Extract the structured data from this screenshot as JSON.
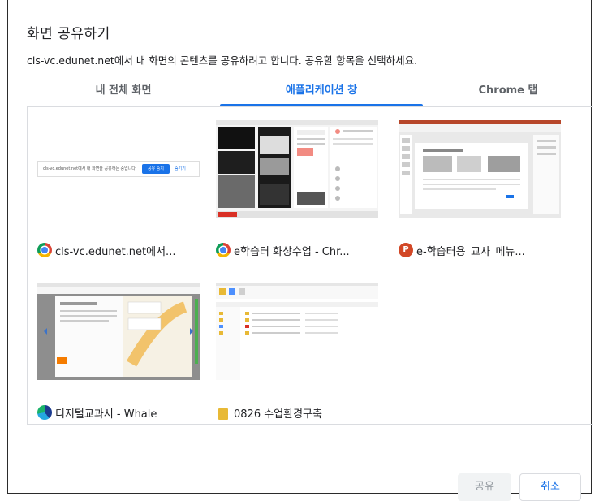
{
  "dialog": {
    "title": "화면 공유하기",
    "subtitle": "cls-vc.edunet.net에서 내 화면의 콘텐츠를 공유하려고 합니다. 공유할 항목을 선택하세요."
  },
  "tabs": [
    {
      "label": "내 전체 화면",
      "active": false
    },
    {
      "label": "애플리케이션 창",
      "active": true
    },
    {
      "label": "Chrome 탭",
      "active": false
    }
  ],
  "windows": [
    {
      "label": "cls-vc.edunet.net에서...",
      "icon": "chrome-icon",
      "preview": {
        "text": "cls-vc.edunet.net에서 내 화면을 공유하는 중입니다.",
        "button": "공유 중지",
        "link": "숨기기"
      }
    },
    {
      "label": "e학습터 화상수업 - Chr...",
      "icon": "chrome-icon"
    },
    {
      "label": "e-학습터용_교사_메뉴...",
      "icon": "powerpoint-icon",
      "icon_glyph": "P"
    },
    {
      "label": "디지털교과서 - Whale",
      "icon": "whale-icon"
    },
    {
      "label": "0826 수업환경구축",
      "icon": "folder-icon"
    }
  ],
  "buttons": {
    "share": "공유",
    "cancel": "취소"
  },
  "colors": {
    "accent": "#1a73e8",
    "border": "#dadce0"
  }
}
